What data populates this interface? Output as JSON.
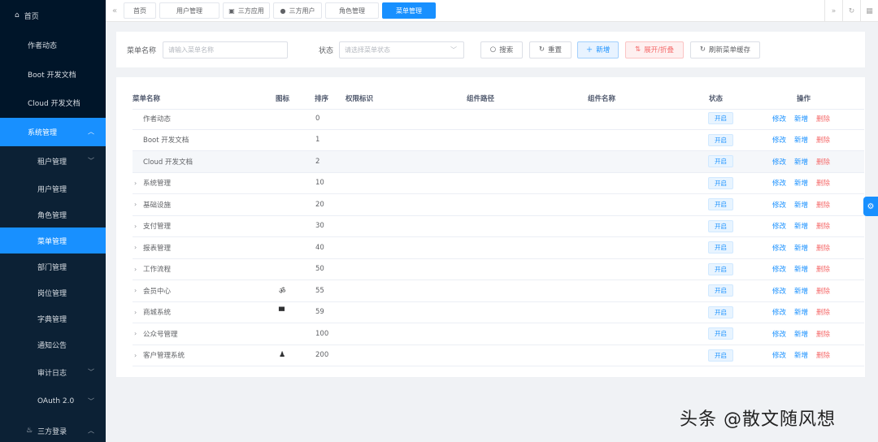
{
  "sidebar": {
    "items": [
      {
        "label": "首页",
        "icon": "home-icon"
      },
      {
        "label": "作者动态"
      },
      {
        "label": "Boot 开发文档"
      },
      {
        "label": "Cloud 开发文档"
      },
      {
        "label": "系统管理"
      },
      {
        "label": "租户管理"
      },
      {
        "label": "用户管理"
      },
      {
        "label": "角色管理"
      },
      {
        "label": "菜单管理"
      },
      {
        "label": "部门管理"
      },
      {
        "label": "岗位管理"
      },
      {
        "label": "字典管理"
      },
      {
        "label": "通知公告"
      },
      {
        "label": "审计日志"
      },
      {
        "label": "OAuth 2.0"
      },
      {
        "label": "三方登录"
      }
    ]
  },
  "tabs": {
    "items": [
      {
        "label": "首页"
      },
      {
        "label": "用户管理"
      },
      {
        "label": "三方应用"
      },
      {
        "label": "三方用户"
      },
      {
        "label": "角色管理"
      },
      {
        "label": "菜单管理"
      }
    ]
  },
  "search": {
    "name_label": "菜单名称",
    "name_placeholder": "请输入菜单名称",
    "status_label": "状态",
    "status_placeholder": "请选择菜单状态",
    "search_btn": "搜索",
    "reset_btn": "重置",
    "add_btn": "新增",
    "toggle_btn": "展开/折叠",
    "refresh_btn": "刷新菜单缓存"
  },
  "table": {
    "headers": {
      "name": "菜单名称",
      "icon": "图标",
      "sort": "排序",
      "perm": "权限标识",
      "path": "组件路径",
      "comp": "组件名称",
      "status": "状态",
      "ops": "操作"
    },
    "rows": [
      {
        "name": "作者动态",
        "sort": "0",
        "status": "开启",
        "expandable": false
      },
      {
        "name": "Boot 开发文档",
        "sort": "1",
        "status": "开启",
        "expandable": false
      },
      {
        "name": "Cloud 开发文档",
        "sort": "2",
        "status": "开启",
        "expandable": false
      },
      {
        "name": "系统管理",
        "sort": "10",
        "status": "开启",
        "expandable": true
      },
      {
        "name": "基础设施",
        "sort": "20",
        "status": "开启",
        "expandable": true
      },
      {
        "name": "支付管理",
        "sort": "30",
        "status": "开启",
        "expandable": true
      },
      {
        "name": "报表管理",
        "sort": "40",
        "status": "开启",
        "expandable": true
      },
      {
        "name": "工作流程",
        "sort": "50",
        "status": "开启",
        "expandable": true
      },
      {
        "name": "会员中心",
        "sort": "55",
        "status": "开启",
        "expandable": true,
        "icon": "bicycle-icon"
      },
      {
        "name": "商城系统",
        "sort": "59",
        "status": "开启",
        "expandable": true,
        "icon": "shop-icon"
      },
      {
        "name": "公众号管理",
        "sort": "100",
        "status": "开启",
        "expandable": true
      },
      {
        "name": "客户管理系统",
        "sort": "200",
        "status": "开启",
        "expandable": true,
        "icon": "user-icon"
      }
    ],
    "actions": {
      "edit": "修改",
      "add": "新增",
      "delete": "删除"
    }
  },
  "watermark": "头条 @散文随风想",
  "colors": {
    "primary": "#1890ff",
    "sidebar": "#001529",
    "danger": "#f56c6c"
  }
}
